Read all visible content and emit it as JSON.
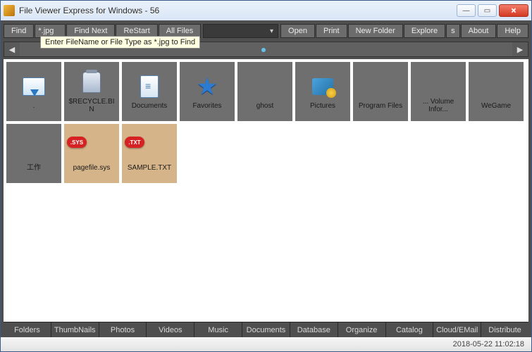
{
  "window": {
    "title": "File Viewer Express for Windows - 56"
  },
  "toolbar": {
    "find": "Find",
    "type_value": "*.jpg",
    "findnext": "Find Next",
    "restart": "ReStart",
    "allfiles": "All Files",
    "open": "Open",
    "print": "Print",
    "newfolder": "New Folder",
    "explore": "Explore",
    "s": "s",
    "about": "About",
    "help": "Help",
    "tooltip": "Enter FileName or File Type as *.jpg to Find"
  },
  "items": [
    {
      "label": ".",
      "icon": "folder-up"
    },
    {
      "label": "$RECYCLE.BIN",
      "icon": "recycle"
    },
    {
      "label": "Documents",
      "icon": "docs"
    },
    {
      "label": "Favorites",
      "icon": "star"
    },
    {
      "label": "ghost",
      "icon": ""
    },
    {
      "label": "Pictures",
      "icon": "pics"
    },
    {
      "label": "Program Files",
      "icon": ""
    },
    {
      "label": "... Volume Infor...",
      "icon": ""
    },
    {
      "label": "WeGame",
      "icon": ""
    },
    {
      "label": "工作",
      "icon": ""
    },
    {
      "label": "pagefile.sys",
      "icon": "",
      "file": true,
      "badge": ".SYS"
    },
    {
      "label": "SAMPLE.TXT",
      "icon": "",
      "file": true,
      "badge": ".TXT"
    }
  ],
  "bottom": [
    "Folders",
    "ThumbNails",
    "Photos",
    "Videos",
    "Music",
    "Documents",
    "Database",
    "Organize",
    "Catalog",
    "Cloud/EMail",
    "Distribute"
  ],
  "status": {
    "datetime": "2018-05-22 11:02:18"
  }
}
